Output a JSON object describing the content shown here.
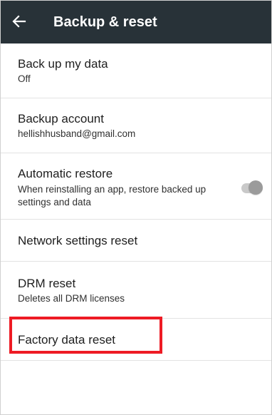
{
  "toolbar": {
    "title": "Backup & reset",
    "back_icon": "arrow-left-icon",
    "background": "#283238"
  },
  "items": [
    {
      "label": "Back up my data",
      "summary": "Off"
    },
    {
      "label": "Backup account",
      "summary": "hellishhusband@gmail.com"
    },
    {
      "label": "Automatic restore",
      "summary": "When reinstalling an app, restore backed up settings and data",
      "toggle": "off"
    },
    {
      "label": "Network settings reset"
    },
    {
      "label": "DRM reset",
      "summary": "Deletes all DRM licenses"
    },
    {
      "label": "Factory data reset"
    }
  ],
  "highlight_color": "#ee1b24"
}
